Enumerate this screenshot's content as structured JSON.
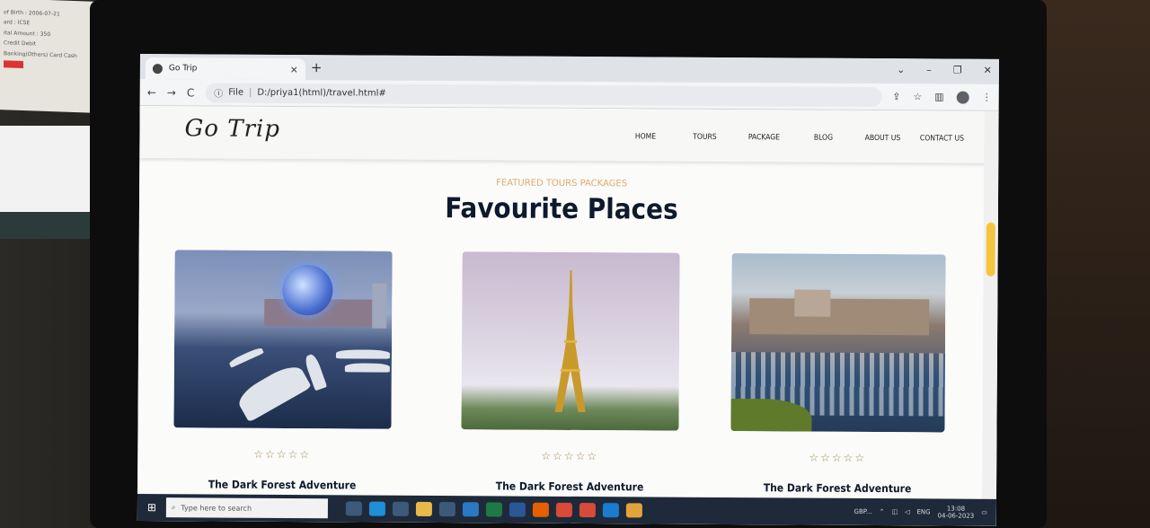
{
  "browser": {
    "tab_title": "Go Trip",
    "tab_close": "×",
    "new_tab": "+",
    "window_controls": [
      "⌄",
      "–",
      "❐",
      "✕"
    ],
    "nav_buttons": [
      "←",
      "→",
      "C"
    ],
    "url_scheme": "File",
    "url": "D:/priya1(html)/travel.html#"
  },
  "site": {
    "logo": "Go Trip",
    "menu": [
      "HOME",
      "TOURS",
      "PACKAGE",
      "BLOG",
      "ABOUT US",
      "CONTACT US"
    ],
    "eyebrow": "FEATURED TOURS PACKAGES",
    "title": "Favourite Places",
    "cards": [
      {
        "title": "The Dark Forest Adventure",
        "stars": "☆☆☆☆☆",
        "scene": "harbor-dome-night"
      },
      {
        "title": "The Dark Forest Adventure",
        "stars": "☆☆☆☆☆",
        "scene": "eiffel-tower"
      },
      {
        "title": "The Dark Forest Adventure",
        "stars": "☆☆☆☆☆",
        "scene": "monaco-marina"
      }
    ]
  },
  "taskbar": {
    "search_placeholder": "Type here to search",
    "tray_label": "GBP...",
    "lang": "ENG",
    "time": "13:08",
    "date": "04-06-2023"
  },
  "background_paper": [
    "of Birth : 2006-07-21",
    "ard : ICSE",
    "ital Amount : 350",
    "Credit Debit",
    "Banking(Others)  Card  Cash"
  ]
}
